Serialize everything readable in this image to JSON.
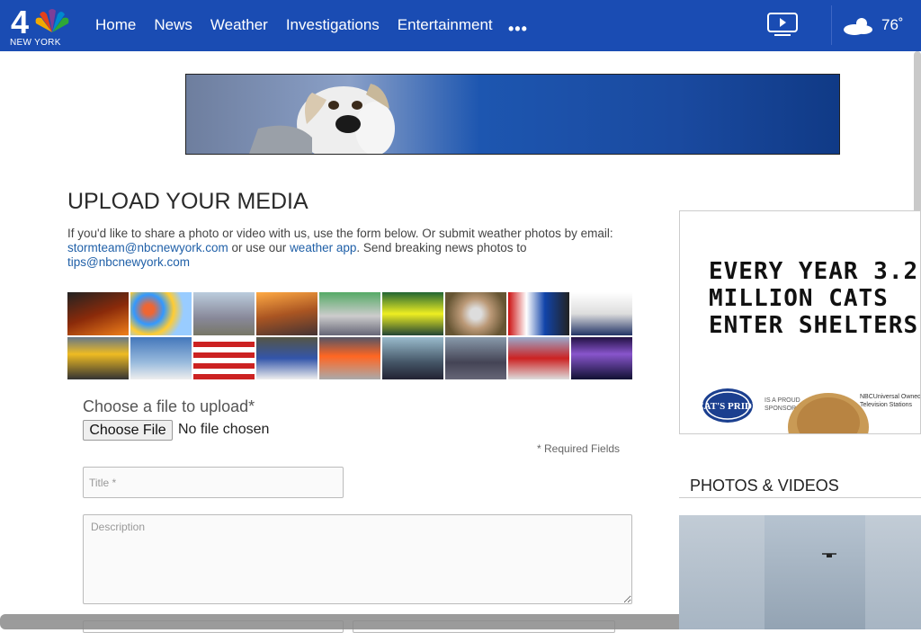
{
  "header": {
    "logo_number": "4",
    "logo_text": "NEW YORK",
    "nav": [
      "Home",
      "News",
      "Weather",
      "Investigations",
      "Entertainment"
    ],
    "more_label": "•••",
    "temperature": "76˚"
  },
  "main": {
    "title": "UPLOAD YOUR MEDIA",
    "intro_prefix": "If you'd like to share a photo or video with us, use the form below. Or submit weather photos by email: ",
    "email_link": "stormteam@nbcnewyork.com",
    "intro_mid": " or use our ",
    "app_link": "weather app",
    "intro_after": ". Send breaking news photos to ",
    "tips_link": "tips@nbcnewyork.com"
  },
  "form": {
    "choose_label": "Choose a file to upload*",
    "file_button": "Choose File",
    "file_status": "No file chosen",
    "required_note": "*  Required Fields",
    "title_placeholder": "Title *",
    "description_placeholder": "Description"
  },
  "ad": {
    "headline": "EVERY YEAR 3.2 MILLION CATS ENTER SHELTERS",
    "brand": "CAT'S PRIDE",
    "sponsor_text": "IS A PROUD SPONSOR",
    "nbc_text": "NBCUniversal Owned Television Stations"
  },
  "sidebar": {
    "photos_title": "PHOTOS & VIDEOS"
  },
  "colors": {
    "header_bg": "#1a4cb3",
    "link": "#2060a8"
  }
}
